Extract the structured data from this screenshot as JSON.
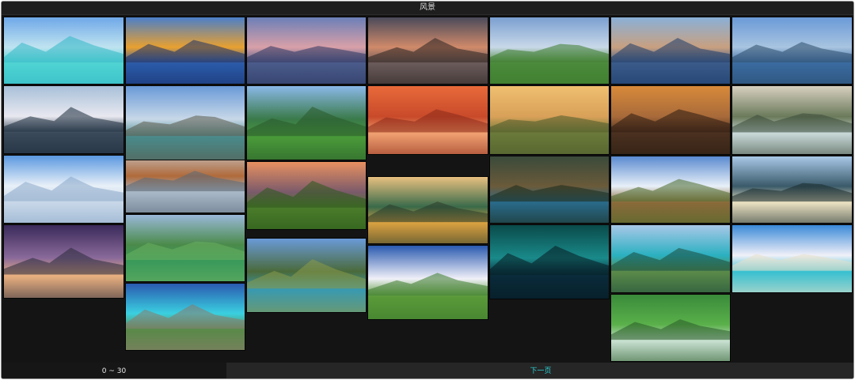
{
  "window": {
    "title": "风景"
  },
  "gallery": {
    "images": [
      {
        "name": "tropical-beach-photo",
        "colors": [
          "#6fa8e8",
          "#bfe3f0",
          "#4fd3d3",
          "#2fb8c4"
        ]
      },
      {
        "name": "mountain-lake-reflection-photo",
        "colors": [
          "#4a7fc9",
          "#e8a030",
          "#2b5aa8",
          "#1a2f6a"
        ]
      },
      {
        "name": "lake-castle-photo",
        "colors": [
          "#6b7fb8",
          "#d9a0a8",
          "#4a5a8a",
          "#2a3560"
        ]
      },
      {
        "name": "sunset-lake-photo",
        "colors": [
          "#4a4a5a",
          "#d08a6a",
          "#6a5a5a",
          "#2a2220"
        ]
      },
      {
        "name": "green-valley-photo",
        "colors": [
          "#7a9fd0",
          "#c8d8e8",
          "#4a8a3a",
          "#3a7a2a"
        ]
      },
      {
        "name": "coastal-village-photo",
        "colors": [
          "#8ab0d8",
          "#c8a080",
          "#3a5a8a",
          "#1a3a6a"
        ]
      },
      {
        "name": "alpine-range-photo",
        "colors": [
          "#6a9ad8",
          "#a8c4e0",
          "#3a6aa0",
          "#2a4a6a"
        ]
      },
      {
        "name": "grass-peak-photo",
        "colors": [
          "#8ab8e8",
          "#3a7a4a",
          "#4a9a3a",
          "#2a5a2a"
        ]
      },
      {
        "name": "autumn-forest-photo",
        "colors": [
          "#e86a3a",
          "#c84a2a",
          "#f0a070",
          "#8a2a1a"
        ]
      },
      {
        "name": "meadow-dusk-photo",
        "colors": [
          "#f0c070",
          "#d8a058",
          "#6a7a3a",
          "#4a5a2a"
        ]
      },
      {
        "name": "mist-valley-photo",
        "colors": [
          "#d88a3a",
          "#a86a3a",
          "#4a3020",
          "#2a1a10"
        ]
      },
      {
        "name": "waterfall-river-photo",
        "colors": [
          "#d8d0c0",
          "#6a7a5a",
          "#c8d8d8",
          "#3a4a3a"
        ]
      },
      {
        "name": "mountain-lake-photo",
        "colors": [
          "#a8c0d8",
          "#e8e8f0",
          "#3a4a5a",
          "#1a2a3a"
        ]
      },
      {
        "name": "foggy-island-lake-photo",
        "colors": [
          "#c8d0d8",
          "#b06a3a",
          "#a8b8c8",
          "#5a6a7a"
        ]
      },
      {
        "name": "field-sunset-photo",
        "colors": [
          "#e89060",
          "#7a5a6a",
          "#4a7a2a",
          "#2a5a1a"
        ]
      },
      {
        "name": "lake-mountain-dusk-photo",
        "colors": [
          "#e8c080",
          "#3a6a4a",
          "#d8a040",
          "#2a3a2a"
        ]
      },
      {
        "name": "cliff-waterfall-photo",
        "colors": [
          "#3a4a3a",
          "#6a5a3a",
          "#2a6a8a",
          "#1a2a1a"
        ]
      },
      {
        "name": "farm-barn-photo",
        "colors": [
          "#5a8ad0",
          "#e8f0f8",
          "#8a6a3a",
          "#4a6a2a"
        ]
      },
      {
        "name": "sunlit-mountain-photo",
        "colors": [
          "#a8c8e8",
          "#3a5a6a",
          "#e8e0c0",
          "#1a2a2a"
        ]
      },
      {
        "name": "snowy-peaks-photo",
        "colors": [
          "#5a98e0",
          "#e8f0f8",
          "#c8d8e8",
          "#8aa8c8"
        ]
      },
      {
        "name": "green-hut-photo",
        "colors": [
          "#9ab8d8",
          "#4a8a4a",
          "#3a9a5a",
          "#6ab060"
        ]
      },
      {
        "name": "alpine-lake-cabin-photo",
        "colors": [
          "#6a9ad8",
          "#4a6a3a",
          "#3a9ab0",
          "#8a9a4a"
        ]
      },
      {
        "name": "cloudy-hill-photo",
        "colors": [
          "#2a5ab0",
          "#f0f0f8",
          "#5a9a3a",
          "#3a7a2a"
        ]
      },
      {
        "name": "aurora-lake-photo",
        "colors": [
          "#0a4a4a",
          "#1a8a8a",
          "#0a2a3a",
          "#051a20"
        ]
      },
      {
        "name": "turquoise-lake-photo",
        "colors": [
          "#a8c8e8",
          "#2ab0c0",
          "#5a8a4a",
          "#1a4a3a"
        ]
      },
      {
        "name": "palm-beach-photo",
        "colors": [
          "#3a8ad8",
          "#f0f0f8",
          "#3ac0d0",
          "#e8e0c8"
        ]
      },
      {
        "name": "pier-dusk-photo",
        "colors": [
          "#3a2a5a",
          "#8a6a9a",
          "#e8b080",
          "#2a2a3a"
        ]
      },
      {
        "name": "rocky-lake-shore-photo",
        "colors": [
          "#6a9ad8",
          "#c8d8e8",
          "#4a8a8a",
          "#5a5a4a"
        ]
      },
      {
        "name": "crystal-lake-photo",
        "colors": [
          "#2a5ab0",
          "#3ad0e0",
          "#5a8a4a",
          "#8a7a6a"
        ]
      },
      {
        "name": "green-falls-photo",
        "colors": [
          "#3a8a3a",
          "#5ab04a",
          "#c8e0d0",
          "#2a5a2a"
        ]
      }
    ]
  },
  "footer": {
    "range_label": "0 ~ 30",
    "next_label": "下一页"
  }
}
